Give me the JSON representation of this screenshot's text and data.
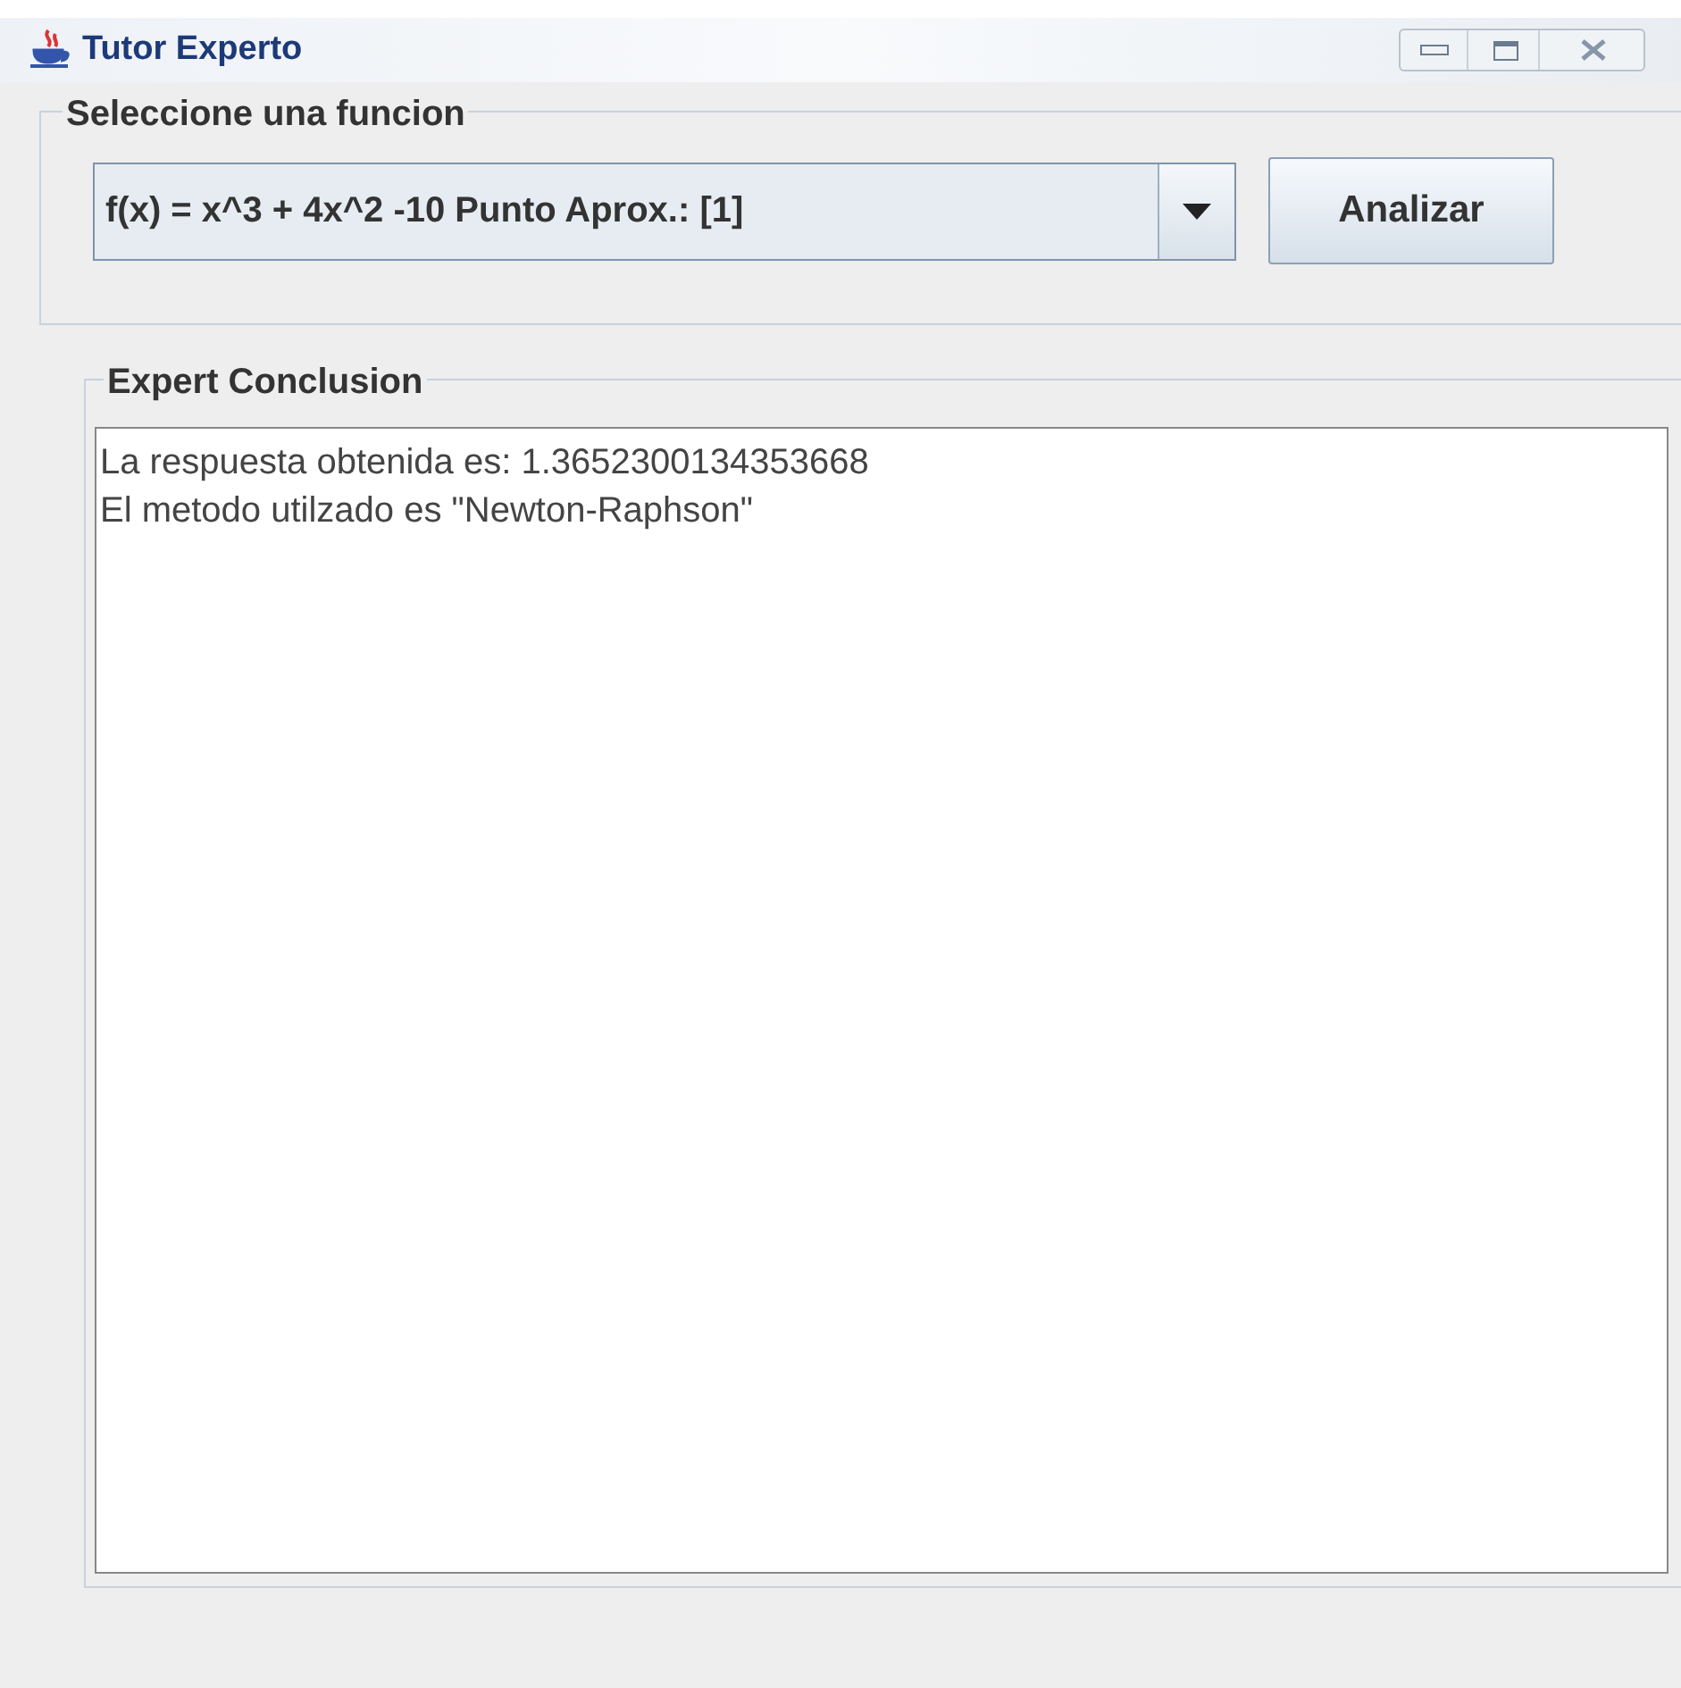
{
  "window": {
    "title": "Tutor Experto"
  },
  "function_group": {
    "title": "Seleccione una funcion",
    "dropdown": {
      "value": "f(x) = x^3 + 4x^2 -10 Punto Aprox.: [1]"
    },
    "button": "Analizar"
  },
  "conclusion_group": {
    "title": "Expert Conclusion",
    "lines": [
      "La respuesta obtenida es: 1.3652300134353668",
      "El metodo utilzado es \"Newton-Raphson\""
    ]
  }
}
